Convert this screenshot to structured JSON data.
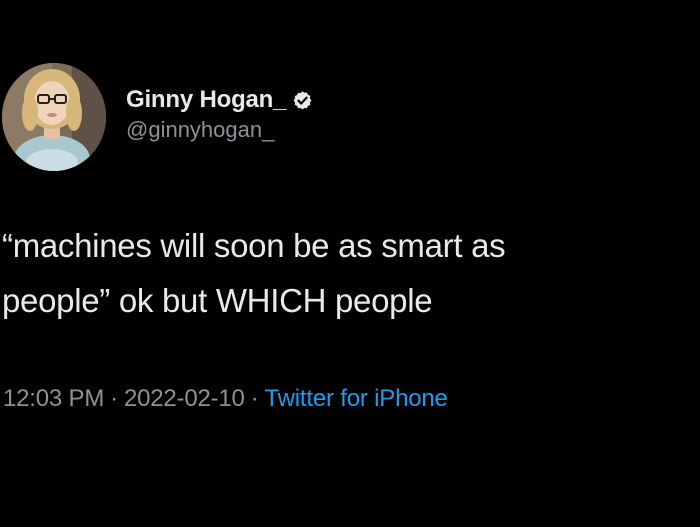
{
  "tweet": {
    "author": {
      "display_name": "Ginny Hogan_",
      "handle": "@ginnyhogan_",
      "verified": true,
      "avatar_icon": "user-avatar"
    },
    "text_line1": "“machines will soon be as smart as",
    "text_line2": "people” ok but WHICH people",
    "time": "12:03 PM",
    "separator": "·",
    "date": "2022-02-10",
    "source": "Twitter for iPhone"
  },
  "colors": {
    "background": "#000000",
    "text": "#e7e9ea",
    "secondary": "#8b9298",
    "link": "#1d9bf0"
  }
}
